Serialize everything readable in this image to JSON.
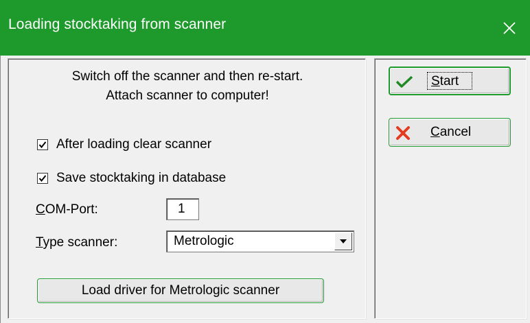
{
  "window": {
    "title": "Loading stocktaking from scanner",
    "title_bar_color": "#1e9a2c",
    "close_icon": "close-icon"
  },
  "message": {
    "line1": "Switch off the scanner and then re-start.",
    "line2": "Attach scanner to computer!"
  },
  "options": {
    "clear_scanner": {
      "label": "After loading clear scanner",
      "checked": true
    },
    "save_db": {
      "label": "Save stocktaking in database",
      "checked": true
    }
  },
  "fields": {
    "com_port": {
      "label_first": "C",
      "label_rest": "OM-Port:",
      "value": "1"
    },
    "type_scanner": {
      "label_first": "T",
      "label_rest": "ype scanner:",
      "value": "Metrologic"
    }
  },
  "buttons": {
    "load_driver": "Load driver for Metrologic scanner",
    "start": {
      "label_first": "S",
      "label_rest": "tart",
      "icon": "checkmark-icon"
    },
    "cancel": {
      "label_first": "C",
      "label_rest": "ancel",
      "icon": "x-cross-icon"
    }
  }
}
